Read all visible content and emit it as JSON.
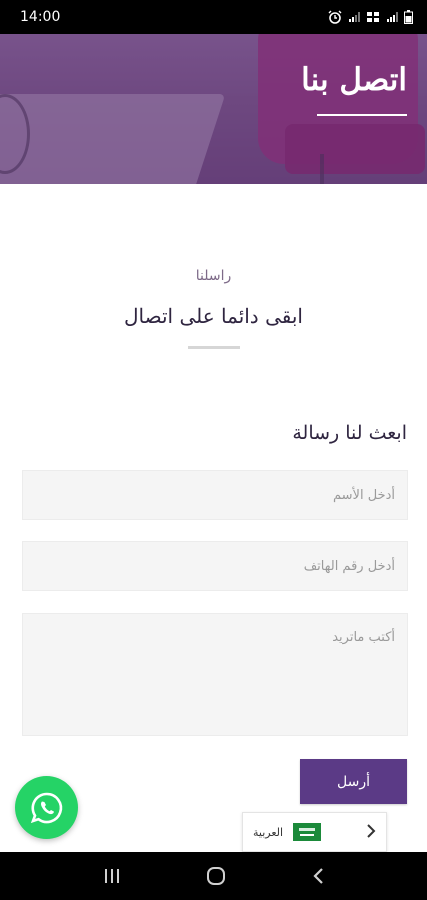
{
  "status_bar": {
    "time": "14:00",
    "icons": [
      "alarm-icon",
      "signal-icon",
      "wifi-calling-icon",
      "signal-icon",
      "battery-icon"
    ]
  },
  "hero": {
    "title": "اتصل بنا"
  },
  "section": {
    "kicker": "راسلنا",
    "title": "ابقى دائما على اتصال"
  },
  "form": {
    "title": "ابعث لنا رسالة",
    "name_placeholder": "أدخل الأسم",
    "phone_placeholder": "أدخل رقم الهاتف",
    "message_placeholder": "أكتب ماتريد",
    "send_label": "أرسل"
  },
  "whatsapp": {
    "icon": "whatsapp-icon"
  },
  "language": {
    "label": "العربية",
    "flag": "saudi-flag-icon",
    "chevron": "chevron-right-icon"
  },
  "nav": {
    "icons": [
      "recent-apps-icon",
      "home-icon",
      "back-icon"
    ]
  },
  "colors": {
    "accent": "#5b3a86",
    "hero_tint": "#6a4579",
    "whatsapp": "#25d366"
  }
}
